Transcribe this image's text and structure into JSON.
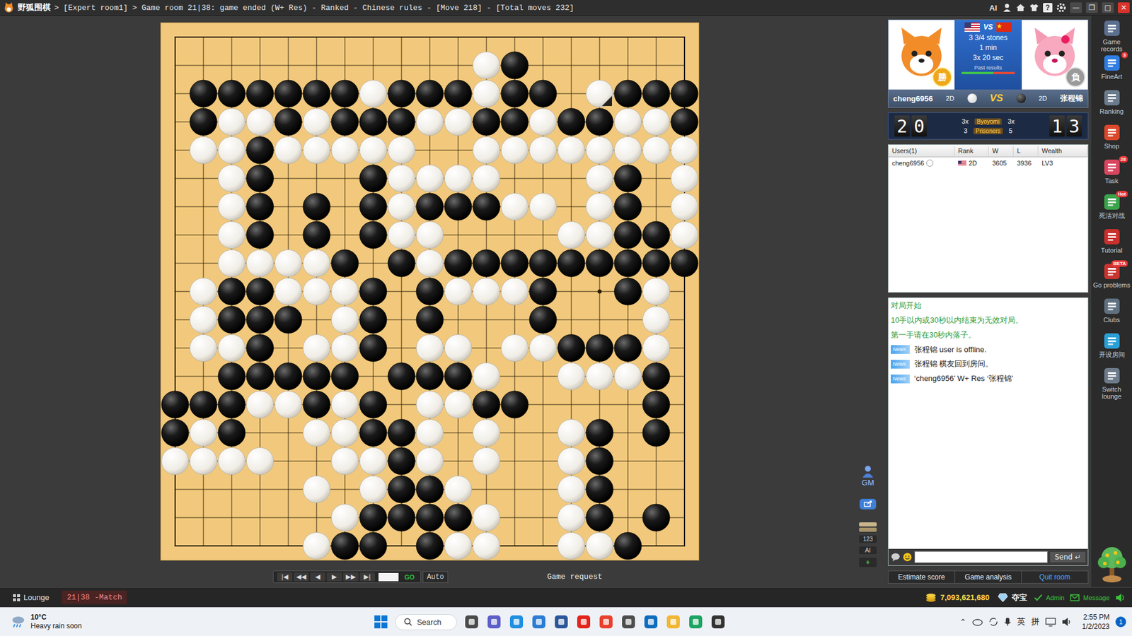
{
  "window": {
    "app_name": "野狐围棋",
    "title": "> [Expert room1] > Game room 21|38: game ended (W+ Res) - Ranked - Chinese rules - [Move 218] - [Total moves 232]",
    "ai_label": "AI",
    "help": "?",
    "controls": [
      {
        "kind": "minimize",
        "glyph": "—"
      },
      {
        "kind": "restore",
        "glyph": "❐"
      },
      {
        "kind": "maximize",
        "glyph": "□"
      },
      {
        "kind": "close",
        "glyph": "✕"
      }
    ]
  },
  "board": {
    "rows": [
      "...................",
      "...........WB......",
      ".BBBBBBWBBBWBB.WBBB",
      ".BWWBWBBBWWBBWBBWWB",
      ".WWBWWWWW..WWWWWWWW",
      "..WB...BWWWW...WB.W",
      "..WB.B.BWBBBWW.WB.W",
      "..WB.B.BWW....WWBBW",
      "..WWWWB.BWBBBBBBBBB",
      ".WBBWWWB.BWWWB..BW.",
      ".WBBB.WB.B...B...W.",
      ".WWB.WWB.WW.WWBBBW.",
      "..BBBBB.BBBW..WWWB.",
      "BBBWWBWB.WWBB....B.",
      "BWB..WWBBW.W..WB.B.",
      "WWWW..WWBW.W..WB...",
      ".....W.WBBW...WB...",
      "......WBBBBW..WB.B.",
      ".....WBB.BWW..WWB.."
    ],
    "last_move": {
      "row": 2,
      "col": 15
    }
  },
  "playback": {
    "buttons": [
      "|◀",
      "◀◀",
      "◀",
      "▶",
      "▶▶",
      "▶|"
    ],
    "move_field": "",
    "go": "GO",
    "auto": "Auto",
    "game_request": "Game request"
  },
  "side_tools": {
    "gm": "GM",
    "buttons": [
      {
        "kind": "share"
      },
      {
        "kind": "stack"
      },
      {
        "kind": "text",
        "label": "123"
      },
      {
        "kind": "text",
        "label": "AI"
      },
      {
        "kind": "text",
        "label": "+"
      }
    ]
  },
  "players": {
    "white": {
      "name": "cheng6956",
      "rank": "2D",
      "badge": "勝"
    },
    "black": {
      "name": "张程锦",
      "rank": "2D",
      "badge": "負"
    },
    "vs": "VS",
    "settings": [
      "3 3/4 stones",
      "1 min",
      "3x 20 sec"
    ],
    "past_results": "Past results"
  },
  "clock": {
    "white_digits": [
      "2",
      "0"
    ],
    "black_digits": [
      "1",
      "3"
    ],
    "white_byoyomi": "3x",
    "byoyomi_label": "Byoyomi",
    "black_byoyomi": "3x",
    "white_prisoners": "3",
    "prisoners_label": "Prisoners",
    "black_prisoners": "5"
  },
  "users": {
    "columns": [
      "Users(1)",
      "Rank",
      "W",
      "L",
      "Wealth"
    ],
    "rows": [
      {
        "name": "cheng6956",
        "rank": "2D",
        "wins": "3605",
        "losses": "3936",
        "wealth": "LV3"
      }
    ]
  },
  "chat": {
    "lines": [
      {
        "kind": "system",
        "text": "对局开始"
      },
      {
        "kind": "system",
        "text": "10手以内或30秒以内结束为无效对局。"
      },
      {
        "kind": "system",
        "text": "第一手请在30秒内落子。"
      },
      {
        "kind": "news",
        "badge": "News",
        "text": "张程锦 user is offline."
      },
      {
        "kind": "news",
        "badge": "News",
        "text": "张程锦 棋友回到房间。"
      },
      {
        "kind": "news",
        "badge": "News",
        "text": "‘cheng6956’ W+ Res ‘张程锦’"
      }
    ],
    "input": "",
    "send": "Send",
    "send_glyph": "↵"
  },
  "actions": [
    {
      "label": "Estimate score",
      "kind": "normal"
    },
    {
      "label": "Game analysis",
      "kind": "normal"
    },
    {
      "label": "Quit room",
      "kind": "exit"
    }
  ],
  "sidebar": [
    {
      "label": "Game records"
    },
    {
      "label": "FineArt",
      "badge": "3"
    },
    {
      "label": "Ranking"
    },
    {
      "label": "Shop"
    },
    {
      "label": "Task",
      "badge": "28"
    },
    {
      "label": "死活对战",
      "badge": "Hot"
    },
    {
      "label": "Tutorial"
    },
    {
      "label": "Go problems",
      "badge": "BETA"
    },
    {
      "label": "Clubs"
    },
    {
      "label": "开设房间"
    },
    {
      "label": "Switch lounge"
    }
  ],
  "status_bar": {
    "tabs": [
      {
        "label": "Lounge",
        "selected": false
      },
      {
        "label": "21|38 -Match",
        "selected": true
      }
    ],
    "coins": "7,093,621,680",
    "treasure": "夺宝",
    "admin": "Admin",
    "message": "Message"
  },
  "taskbar": {
    "temperature": "10°C",
    "weather": "Heavy rain soon",
    "search": "Search",
    "input_indicators": [
      "英",
      "拼"
    ],
    "time": "2:55 PM",
    "date": "1/2/2023",
    "notifications": "1"
  }
}
